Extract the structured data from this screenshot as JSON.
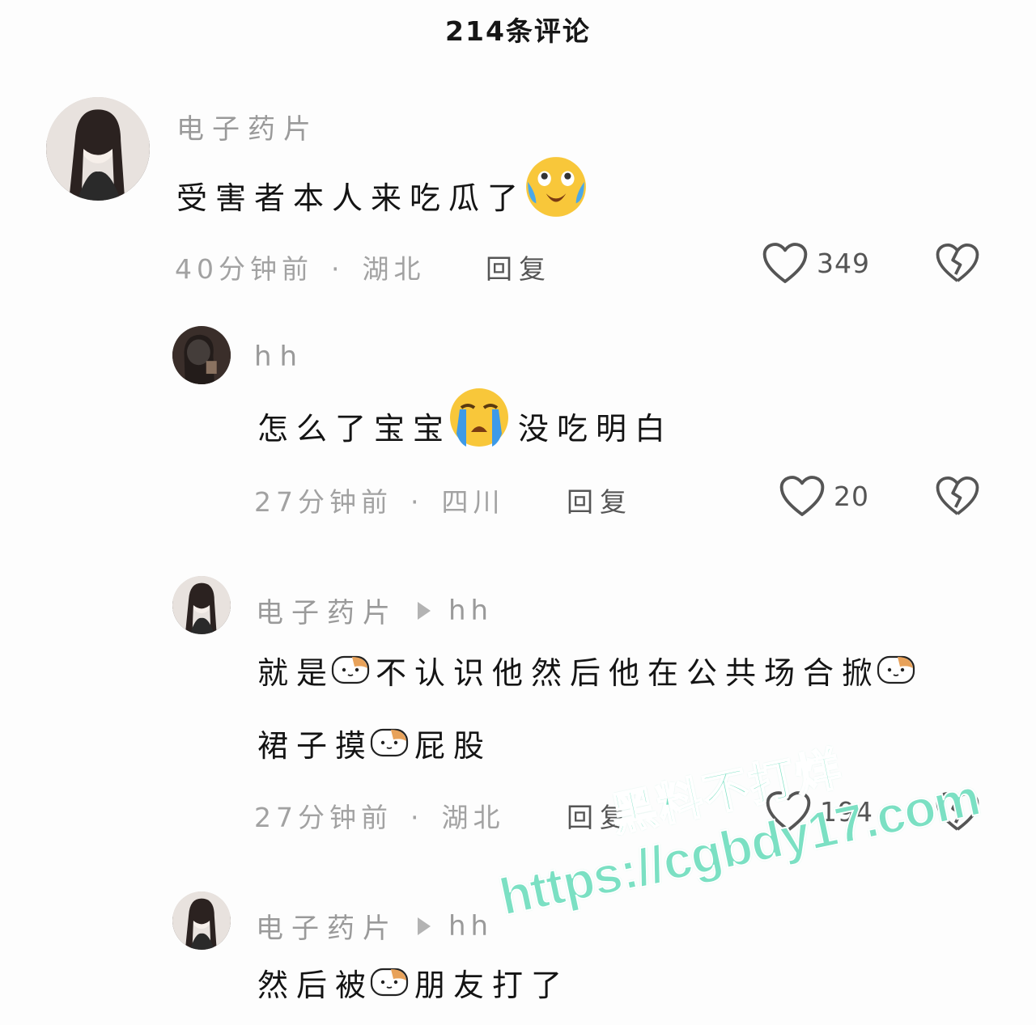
{
  "header": {
    "title": "214条评论"
  },
  "comments": [
    {
      "author": "电子药片",
      "text": "受害者本人来吃瓜了",
      "time": "40分钟前",
      "location": "湖北",
      "reply": "回复",
      "likes": "349"
    },
    {
      "author": "hh",
      "text_a": "怎么了宝宝",
      "text_b": "没吃明白",
      "time": "27分钟前",
      "location": "四川",
      "reply": "回复",
      "likes": "20"
    },
    {
      "author": "电子药片",
      "target": "hh",
      "line1": [
        "就是",
        "不认识他然后他在公共场合掀"
      ],
      "line2": [
        "裙子摸",
        "屁股"
      ],
      "time": "27分钟前",
      "location": "湖北",
      "reply": "回复",
      "likes": "194"
    },
    {
      "author": "电子药片",
      "target": "hh",
      "text_a": "然后被",
      "text_b": "朋友打了"
    }
  ],
  "watermark": {
    "line1": "黑料不打烊",
    "line2": "https://cgbdy17.com"
  },
  "icons": {
    "like": "heart-outline-icon",
    "dislike": "broken-heart-icon",
    "reply_arrow": "triangle-right-icon"
  }
}
